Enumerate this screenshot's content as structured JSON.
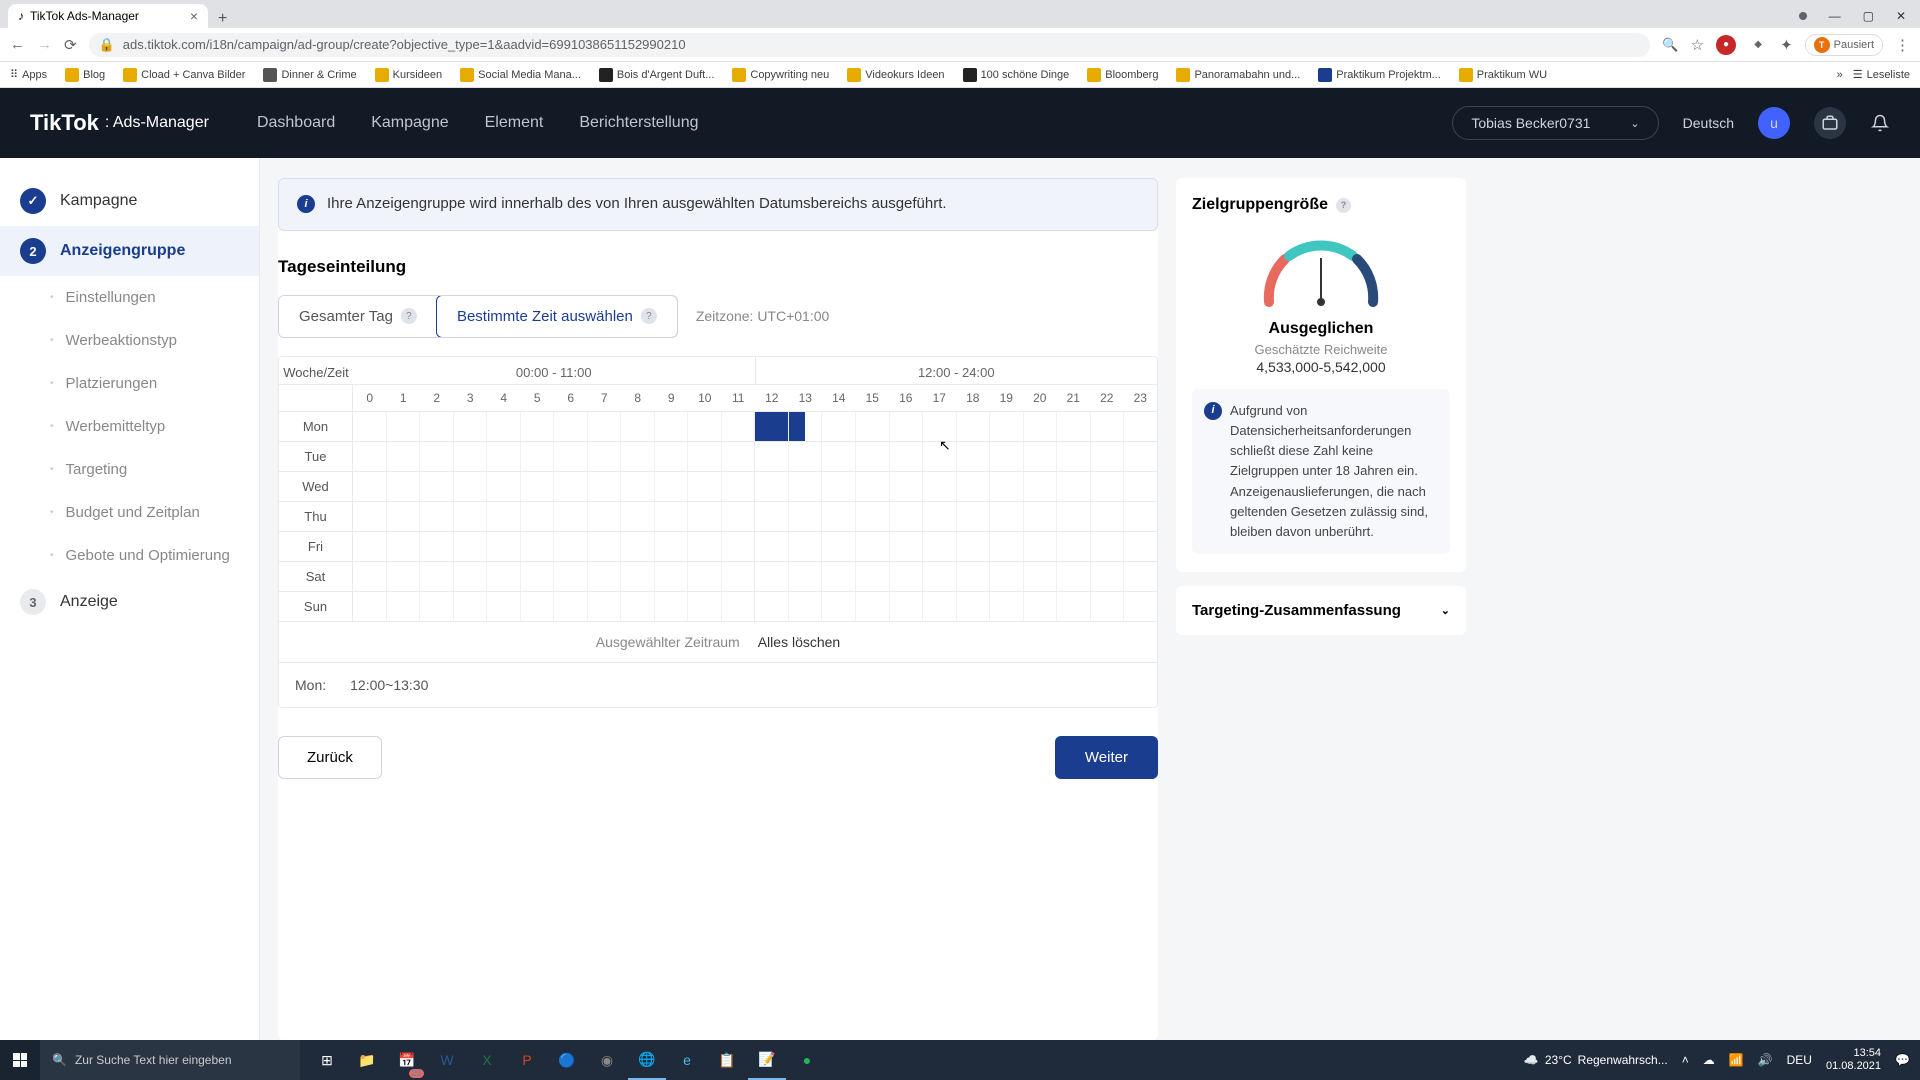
{
  "browser": {
    "tab_title": "TikTok Ads-Manager",
    "url": "ads.tiktok.com/i18n/campaign/ad-group/create?objective_type=1&aadvid=6991038651152990210",
    "paused": "Pausiert",
    "bookmarks": [
      "Apps",
      "Blog",
      "Cload + Canva Bilder",
      "Dinner & Crime",
      "Kursideen",
      "Social Media Mana...",
      "Bois d'Argent Duft...",
      "Copywriting neu",
      "Videokurs Ideen",
      "100 schöne Dinge",
      "Bloomberg",
      "Panoramabahn und...",
      "Praktikum Projektm...",
      "Praktikum WU"
    ],
    "reading_list": "Leseliste"
  },
  "header": {
    "logo_main": "TikTok",
    "logo_sub": ": Ads-Manager",
    "nav": [
      "Dashboard",
      "Kampagne",
      "Element",
      "Berichterstellung"
    ],
    "user": "Tobias Becker0731",
    "lang": "Deutsch",
    "avatar_letter": "u"
  },
  "sidebar": {
    "steps": [
      {
        "label": "Kampagne",
        "state": "done"
      },
      {
        "label": "Anzeigengruppe",
        "state": "active"
      },
      {
        "label": "Anzeige",
        "state": "pending"
      }
    ],
    "substeps": [
      "Einstellungen",
      "Werbeaktionstyp",
      "Platzierungen",
      "Werbemitteltyp",
      "Targeting",
      "Budget und Zeitplan",
      "Gebote und Optimierung"
    ]
  },
  "main": {
    "info_text": "Ihre Anzeigengruppe wird innerhalb des von Ihren ausgewählten Datumsbereichs ausgeführt.",
    "section_title": "Tageseinteilung",
    "toggle_all": "Gesamter Tag",
    "toggle_specific": "Bestimmte Zeit auswählen",
    "timezone_label": "Zeitzone: UTC+01:00",
    "week_time": "Woche/Zeit",
    "time_groups": [
      "00:00 - 11:00",
      "12:00 - 24:00"
    ],
    "hours": [
      "0",
      "1",
      "2",
      "3",
      "4",
      "5",
      "6",
      "7",
      "8",
      "9",
      "10",
      "11",
      "12",
      "13",
      "14",
      "15",
      "16",
      "17",
      "18",
      "19",
      "20",
      "21",
      "22",
      "23"
    ],
    "days": [
      "Mon",
      "Tue",
      "Wed",
      "Thu",
      "Fri",
      "Sat",
      "Sun"
    ],
    "selected_cells": {
      "Mon": [
        12,
        13,
        14
      ]
    },
    "selected_label": "Ausgewählter Zeitraum",
    "clear_all": "Alles löschen",
    "summary_day": "Mon:",
    "summary_time": "12:00~13:30",
    "back": "Zurück",
    "next": "Weiter"
  },
  "right": {
    "audience_title": "Zielgruppengröße",
    "gauge_label": "Ausgeglichen",
    "gauge_sub": "Geschätzte Reichweite",
    "gauge_reach": "4,533,000-5,542,000",
    "note": "Aufgrund von Datensicherheitsanforderungen schließt diese Zahl keine Zielgruppen unter 18 Jahren ein. Anzeigenauslieferungen, die nach geltenden Gesetzen zulässig sind, bleiben davon unberührt.",
    "targeting_summary": "Targeting-Zusammenfassung"
  },
  "taskbar": {
    "search_placeholder": "Zur Suche Text hier eingeben",
    "calendar_badge": "23",
    "weather_temp": "23°C",
    "weather_text": "Regenwahrsch...",
    "lang_code": "DEU",
    "time": "13:54",
    "date": "01.08.2021"
  }
}
